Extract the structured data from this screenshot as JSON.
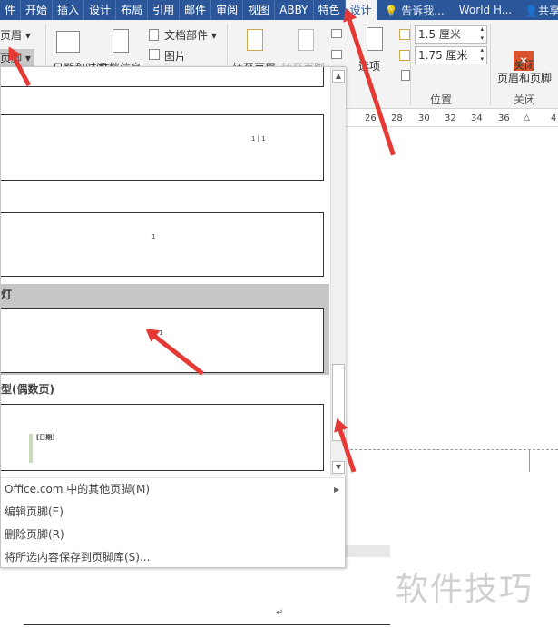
{
  "tabs": [
    "件",
    "开始",
    "插入",
    "设计",
    "布局",
    "引用",
    "邮件",
    "审阅",
    "视图",
    "ABBY",
    "特色",
    "设计"
  ],
  "tell_me": "告诉我...",
  "user": "World H...",
  "share": "共享",
  "ribbon": {
    "header": "页眉",
    "footer": "页脚",
    "date_time": "日期和时间",
    "doc_info": "文档信息",
    "quick_parts": "文档部件",
    "picture": "图片",
    "goto_header": "转至页眉",
    "goto_footer": "转至页脚",
    "options": "选项",
    "header_pos": "1.5 厘米",
    "footer_pos": "1.75 厘米",
    "position_group": "位置",
    "close_btn": "关闭\n页眉和页脚",
    "close_group": "关闭"
  },
  "ruler": [
    "26",
    "28",
    "30",
    "32",
    "34",
    "36",
    "4"
  ],
  "gallery": {
    "item1_text": "1 | 1",
    "item2_text": "1",
    "header3": "灯",
    "item3_text": "1 / 1",
    "header4": "型(偶数页)",
    "item4_text": "[日期]"
  },
  "menu": [
    "Office.com 中的其他页脚(M)",
    "编辑页脚(E)",
    "删除页脚(R)",
    "将所选内容保存到页脚库(S)..."
  ],
  "watermark": "软件技巧",
  "doc_mark": "↵"
}
